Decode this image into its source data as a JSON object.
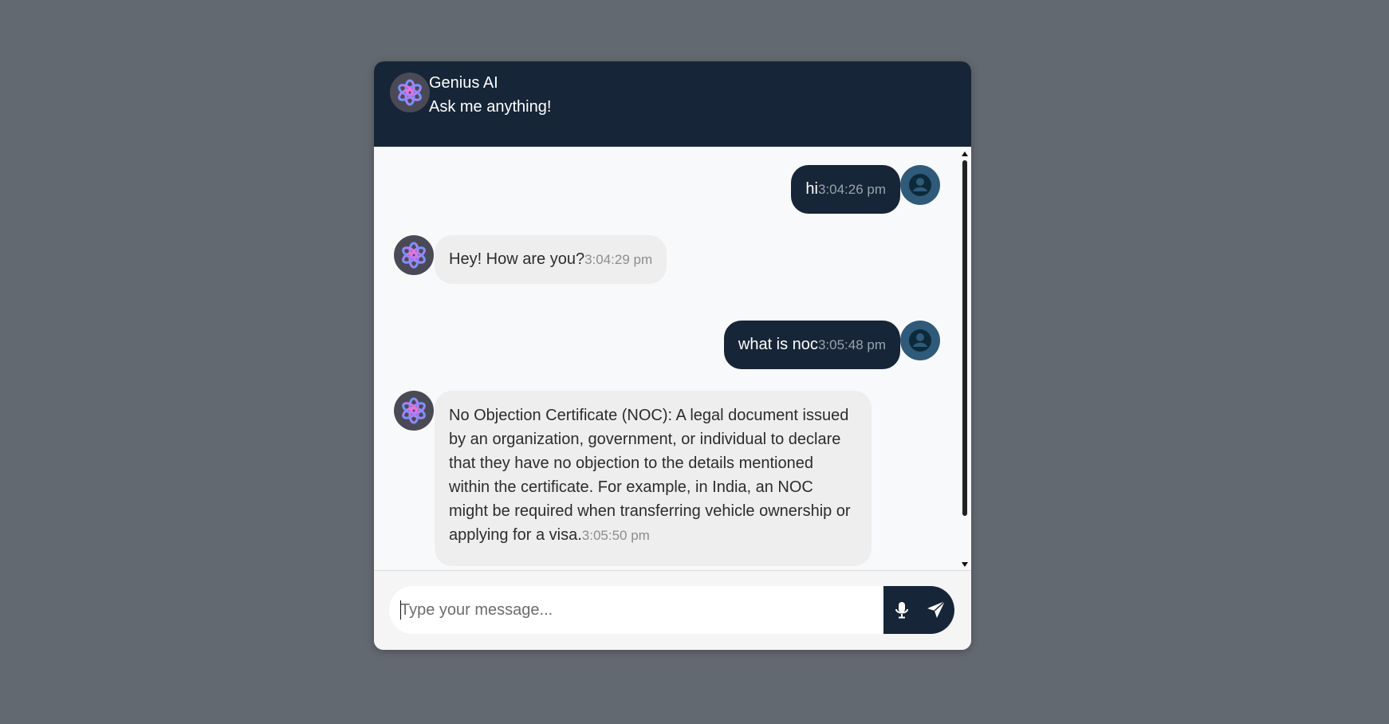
{
  "header": {
    "title": "Genius AI",
    "subtitle": "Ask me anything!",
    "avatar_icon": "openai-logo-icon"
  },
  "messages": [
    {
      "sender": "user",
      "text": "hi",
      "time": "3:04:26 pm"
    },
    {
      "sender": "bot",
      "text": "Hey! How are you?",
      "time": "3:04:29 pm"
    },
    {
      "sender": "user",
      "text": "what is noc",
      "time": "3:05:48 pm"
    },
    {
      "sender": "bot",
      "lines": [
        "No Objection Certificate (NOC): A legal document issued",
        "by an organization, government, or individual to declare",
        "that they have no objection to the details mentioned",
        "within the certificate. For example, in India, an NOC",
        "might be required when transferring vehicle ownership or",
        "applying for a visa."
      ],
      "time": "3:05:50 pm"
    }
  ],
  "input": {
    "placeholder": "Type your message...",
    "value": ""
  },
  "buttons": {
    "mic_icon": "microphone-icon",
    "send_icon": "send-icon"
  },
  "colors": {
    "background": "#636970",
    "header": "#162537",
    "user_bubble": "#162537",
    "bot_bubble": "#eeeeee",
    "user_avatar": "#2f5a7a"
  }
}
